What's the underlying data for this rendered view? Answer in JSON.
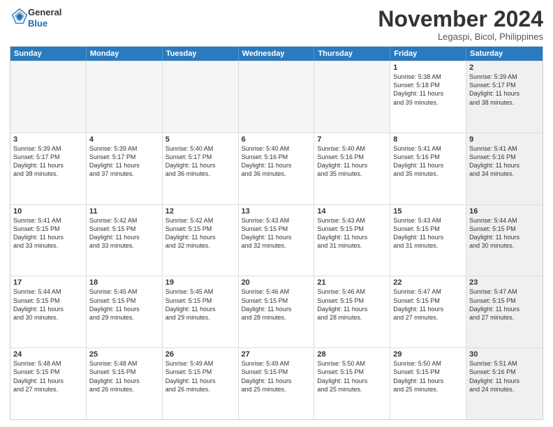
{
  "header": {
    "logo_line1": "General",
    "logo_line2": "Blue",
    "month": "November 2024",
    "location": "Legaspi, Bicol, Philippines"
  },
  "days_of_week": [
    "Sunday",
    "Monday",
    "Tuesday",
    "Wednesday",
    "Thursday",
    "Friday",
    "Saturday"
  ],
  "weeks": [
    [
      {
        "day": "",
        "info": "",
        "empty": true
      },
      {
        "day": "",
        "info": "",
        "empty": true
      },
      {
        "day": "",
        "info": "",
        "empty": true
      },
      {
        "day": "",
        "info": "",
        "empty": true
      },
      {
        "day": "",
        "info": "",
        "empty": true
      },
      {
        "day": "1",
        "info": "Sunrise: 5:38 AM\nSunset: 5:18 PM\nDaylight: 11 hours\nand 39 minutes.",
        "empty": false
      },
      {
        "day": "2",
        "info": "Sunrise: 5:39 AM\nSunset: 5:17 PM\nDaylight: 11 hours\nand 38 minutes.",
        "empty": false,
        "shaded": true
      }
    ],
    [
      {
        "day": "3",
        "info": "Sunrise: 5:39 AM\nSunset: 5:17 PM\nDaylight: 11 hours\nand 38 minutes.",
        "empty": false
      },
      {
        "day": "4",
        "info": "Sunrise: 5:39 AM\nSunset: 5:17 PM\nDaylight: 11 hours\nand 37 minutes.",
        "empty": false
      },
      {
        "day": "5",
        "info": "Sunrise: 5:40 AM\nSunset: 5:17 PM\nDaylight: 11 hours\nand 36 minutes.",
        "empty": false
      },
      {
        "day": "6",
        "info": "Sunrise: 5:40 AM\nSunset: 5:16 PM\nDaylight: 11 hours\nand 36 minutes.",
        "empty": false
      },
      {
        "day": "7",
        "info": "Sunrise: 5:40 AM\nSunset: 5:16 PM\nDaylight: 11 hours\nand 35 minutes.",
        "empty": false
      },
      {
        "day": "8",
        "info": "Sunrise: 5:41 AM\nSunset: 5:16 PM\nDaylight: 11 hours\nand 35 minutes.",
        "empty": false
      },
      {
        "day": "9",
        "info": "Sunrise: 5:41 AM\nSunset: 5:16 PM\nDaylight: 11 hours\nand 34 minutes.",
        "empty": false,
        "shaded": true
      }
    ],
    [
      {
        "day": "10",
        "info": "Sunrise: 5:41 AM\nSunset: 5:15 PM\nDaylight: 11 hours\nand 33 minutes.",
        "empty": false
      },
      {
        "day": "11",
        "info": "Sunrise: 5:42 AM\nSunset: 5:15 PM\nDaylight: 11 hours\nand 33 minutes.",
        "empty": false
      },
      {
        "day": "12",
        "info": "Sunrise: 5:42 AM\nSunset: 5:15 PM\nDaylight: 11 hours\nand 32 minutes.",
        "empty": false
      },
      {
        "day": "13",
        "info": "Sunrise: 5:43 AM\nSunset: 5:15 PM\nDaylight: 11 hours\nand 32 minutes.",
        "empty": false
      },
      {
        "day": "14",
        "info": "Sunrise: 5:43 AM\nSunset: 5:15 PM\nDaylight: 11 hours\nand 31 minutes.",
        "empty": false
      },
      {
        "day": "15",
        "info": "Sunrise: 5:43 AM\nSunset: 5:15 PM\nDaylight: 11 hours\nand 31 minutes.",
        "empty": false
      },
      {
        "day": "16",
        "info": "Sunrise: 5:44 AM\nSunset: 5:15 PM\nDaylight: 11 hours\nand 30 minutes.",
        "empty": false,
        "shaded": true
      }
    ],
    [
      {
        "day": "17",
        "info": "Sunrise: 5:44 AM\nSunset: 5:15 PM\nDaylight: 11 hours\nand 30 minutes.",
        "empty": false
      },
      {
        "day": "18",
        "info": "Sunrise: 5:45 AM\nSunset: 5:15 PM\nDaylight: 11 hours\nand 29 minutes.",
        "empty": false
      },
      {
        "day": "19",
        "info": "Sunrise: 5:45 AM\nSunset: 5:15 PM\nDaylight: 11 hours\nand 29 minutes.",
        "empty": false
      },
      {
        "day": "20",
        "info": "Sunrise: 5:46 AM\nSunset: 5:15 PM\nDaylight: 11 hours\nand 28 minutes.",
        "empty": false
      },
      {
        "day": "21",
        "info": "Sunrise: 5:46 AM\nSunset: 5:15 PM\nDaylight: 11 hours\nand 28 minutes.",
        "empty": false
      },
      {
        "day": "22",
        "info": "Sunrise: 5:47 AM\nSunset: 5:15 PM\nDaylight: 11 hours\nand 27 minutes.",
        "empty": false
      },
      {
        "day": "23",
        "info": "Sunrise: 5:47 AM\nSunset: 5:15 PM\nDaylight: 11 hours\nand 27 minutes.",
        "empty": false,
        "shaded": true
      }
    ],
    [
      {
        "day": "24",
        "info": "Sunrise: 5:48 AM\nSunset: 5:15 PM\nDaylight: 11 hours\nand 27 minutes.",
        "empty": false
      },
      {
        "day": "25",
        "info": "Sunrise: 5:48 AM\nSunset: 5:15 PM\nDaylight: 11 hours\nand 26 minutes.",
        "empty": false
      },
      {
        "day": "26",
        "info": "Sunrise: 5:49 AM\nSunset: 5:15 PM\nDaylight: 11 hours\nand 26 minutes.",
        "empty": false
      },
      {
        "day": "27",
        "info": "Sunrise: 5:49 AM\nSunset: 5:15 PM\nDaylight: 11 hours\nand 25 minutes.",
        "empty": false
      },
      {
        "day": "28",
        "info": "Sunrise: 5:50 AM\nSunset: 5:15 PM\nDaylight: 11 hours\nand 25 minutes.",
        "empty": false
      },
      {
        "day": "29",
        "info": "Sunrise: 5:50 AM\nSunset: 5:15 PM\nDaylight: 11 hours\nand 25 minutes.",
        "empty": false
      },
      {
        "day": "30",
        "info": "Sunrise: 5:51 AM\nSunset: 5:16 PM\nDaylight: 11 hours\nand 24 minutes.",
        "empty": false,
        "shaded": true
      }
    ]
  ]
}
